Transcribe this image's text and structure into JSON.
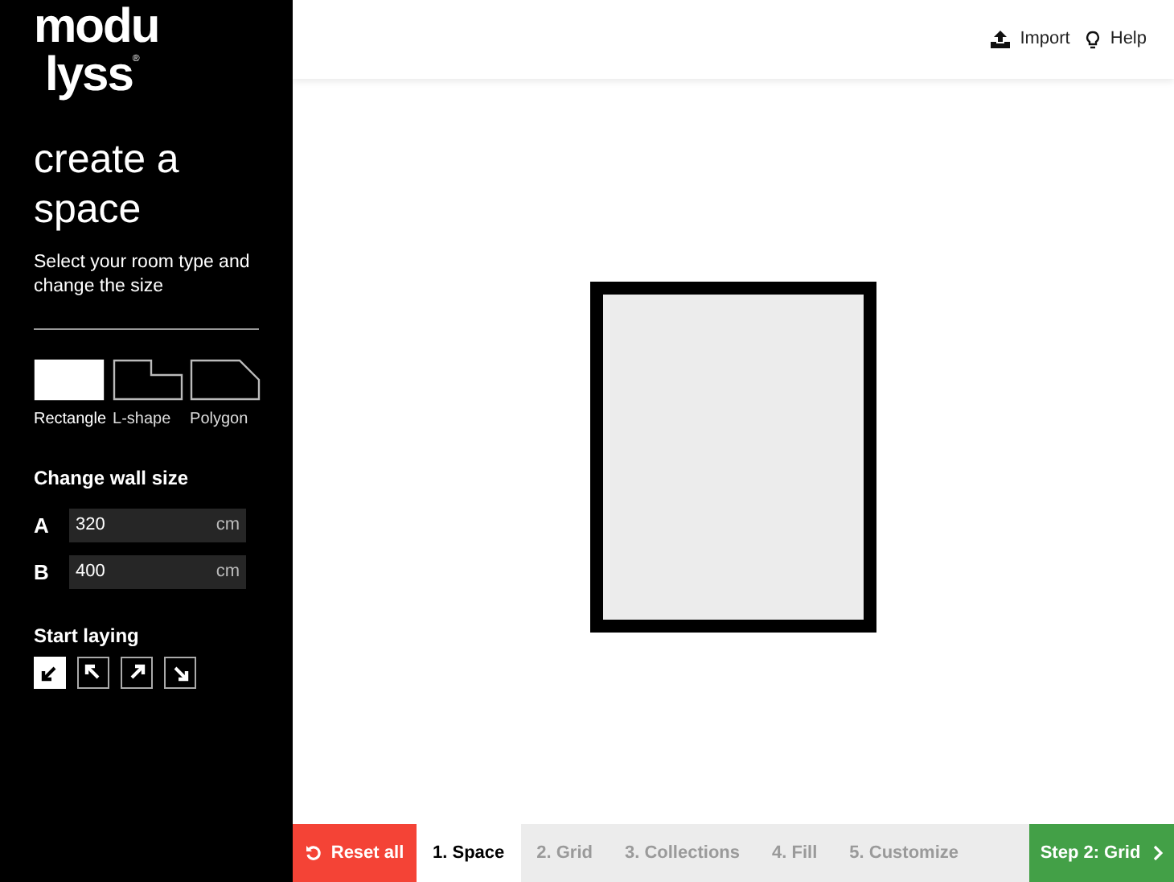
{
  "logo": {
    "line1": "modu",
    "line2": "lyss",
    "mark": "®"
  },
  "heading": "create a space",
  "intro": "Select your room type and change the size",
  "room_types": [
    {
      "label": "Rectangle",
      "kind": "rectangle",
      "selected": true
    },
    {
      "label": "L-shape",
      "kind": "lshape",
      "selected": false
    },
    {
      "label": "Polygon",
      "kind": "polygon",
      "selected": false
    }
  ],
  "wall_size": {
    "title": "Change wall size",
    "walls": [
      {
        "label": "A",
        "value": "320",
        "unit": "cm"
      },
      {
        "label": "B",
        "value": "400",
        "unit": "cm"
      }
    ]
  },
  "start_laying": {
    "title": "Start laying",
    "corners": [
      {
        "kind": "bottom-left",
        "selected": true
      },
      {
        "kind": "top-left",
        "selected": false
      },
      {
        "kind": "top-right",
        "selected": false
      },
      {
        "kind": "bottom-right",
        "selected": false
      }
    ]
  },
  "top_actions": [
    {
      "label": "Import",
      "kind": "import"
    },
    {
      "label": "Help",
      "kind": "help"
    }
  ],
  "reset": "Reset all",
  "steps": [
    {
      "label": "1. Space",
      "selected": true
    },
    {
      "label": "2. Grid",
      "selected": false
    },
    {
      "label": "3. Collections",
      "selected": false
    },
    {
      "label": "4. Fill",
      "selected": false
    },
    {
      "label": "5. Customize",
      "selected": false
    }
  ],
  "next": "Step 2: Grid"
}
